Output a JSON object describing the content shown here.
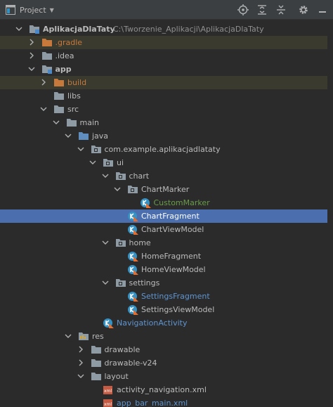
{
  "toolbar": {
    "title": "Project",
    "icons": [
      "locate-icon",
      "expand-all-icon",
      "collapse-all-icon",
      "settings-gear-icon",
      "hide-icon"
    ]
  },
  "tree": {
    "rows": [
      {
        "label": "AplikacjaDlaTaty",
        "path": "C:\\Tworzenie_Aplikacji\\AplikacjaDlaTaty"
      },
      {
        "label": ".gradle"
      },
      {
        "label": ".idea"
      },
      {
        "label": "app"
      },
      {
        "label": "build"
      },
      {
        "label": "libs"
      },
      {
        "label": "src"
      },
      {
        "label": "main"
      },
      {
        "label": "java"
      },
      {
        "label": "com.example.aplikacjadlataty"
      },
      {
        "label": "ui"
      },
      {
        "label": "chart"
      },
      {
        "label": "ChartMarker"
      },
      {
        "label": "CustomMarker"
      },
      {
        "label": "ChartFragment"
      },
      {
        "label": "ChartViewModel"
      },
      {
        "label": "home"
      },
      {
        "label": "HomeFragment"
      },
      {
        "label": "HomeViewModel"
      },
      {
        "label": "settings"
      },
      {
        "label": "SettingsFragment"
      },
      {
        "label": "SettingsViewModel"
      },
      {
        "label": "NavigationActivity"
      },
      {
        "label": "res"
      },
      {
        "label": "drawable"
      },
      {
        "label": "drawable-v24"
      },
      {
        "label": "layout"
      },
      {
        "label": "activity_navigation.xml"
      },
      {
        "label": "app_bar_main.xml"
      }
    ]
  },
  "colors": {
    "selection": "#4b6eaf",
    "excluded_folder": "#c7793c",
    "modified_green": "#6a9a4a",
    "modified_blue": "#5d95d3"
  }
}
